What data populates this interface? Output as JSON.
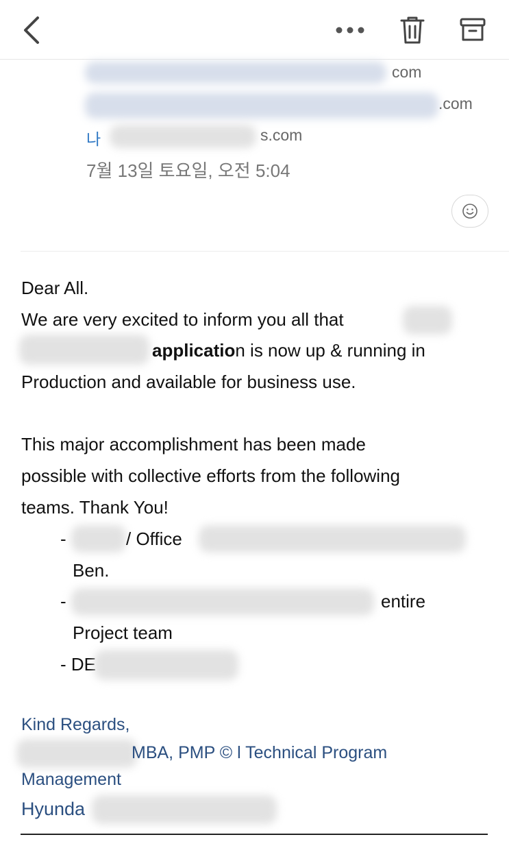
{
  "toolbar": {
    "back_icon": "chevron-left-icon",
    "more_icon": "more-horizontal-icon",
    "trash_icon": "trash-icon",
    "archive_icon": "archive-icon"
  },
  "header": {
    "recipient_1_suffix": "com",
    "recipient_2_suffix": ".com",
    "me_label": "나",
    "me_suffix": "s.com",
    "date": "7월 13일 토요일, 오전 5:04"
  },
  "message": {
    "greeting": "Dear All.",
    "line_1": "We are very excited to inform you all that",
    "line_2_bold": "applicatio",
    "line_2_rest": "n is now up & running in",
    "line_3": "Production and available for business use.",
    "line_4": "This major accomplishment has been made",
    "line_5": "possible with collective efforts from the following",
    "line_6": "teams. Thank You!",
    "bullets": [
      {
        "dash": "-",
        "text": "/ Office",
        "tail": "Ben."
      },
      {
        "dash": "-",
        "text": "entire",
        "tail": "Project team"
      },
      {
        "dash": "- DE",
        "text": "",
        "tail": ""
      }
    ]
  },
  "signature": {
    "closing": "Kind Regards,",
    "title_line": "MBA, PMP © l Technical Program",
    "title_line_2": "Management",
    "company": "Hyunda"
  },
  "colors": {
    "link_blue": "#2f78c4",
    "signature_blue": "#2b4f80"
  }
}
